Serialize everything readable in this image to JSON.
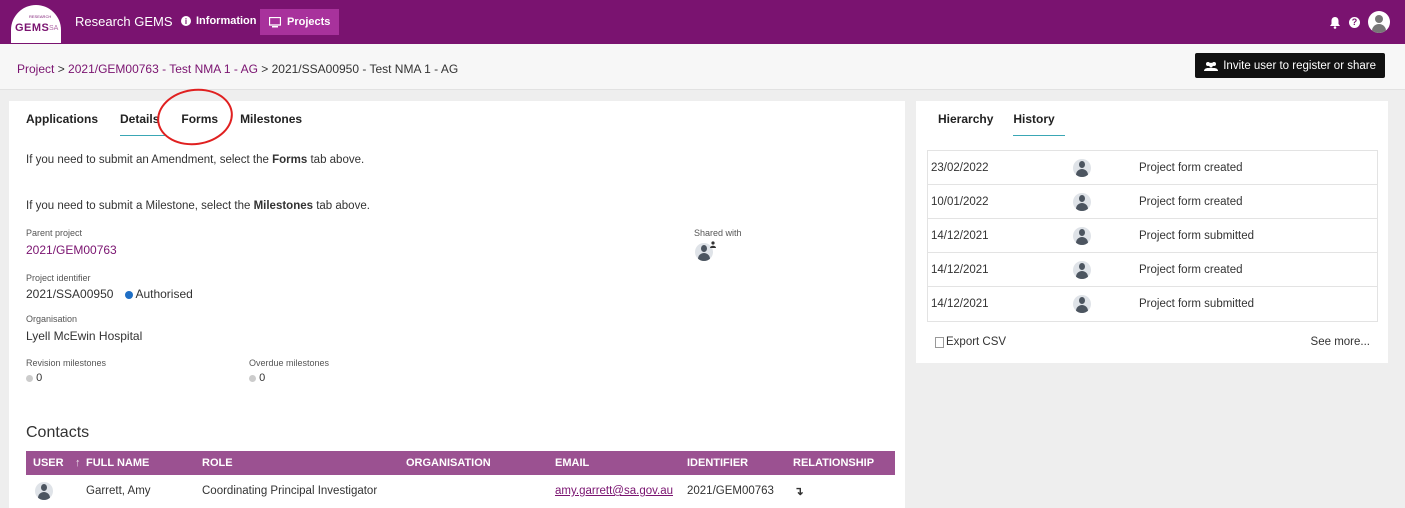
{
  "nav": {
    "logo_top": "RESEARCH",
    "logo_main": "GEMS",
    "logo_suffix": "SA",
    "brand": "Research GEMS",
    "info": "Information",
    "projects": "Projects"
  },
  "breadcrumb": {
    "root": "Project",
    "sep1": " > ",
    "parent": "2021/GEM00763 - Test NMA 1 - AG",
    "sep2": " > ",
    "current": "2021/SSA00950 - Test NMA 1 - AG"
  },
  "invite_button": "Invite user to register or share",
  "tabs": [
    "Applications",
    "Details",
    "Forms",
    "Milestones"
  ],
  "details": {
    "amend_pre": "If you need to submit an Amendment, select the ",
    "amend_bold": "Forms",
    "amend_post": " tab above.",
    "mile_pre": "If you need to submit a Milestone, select the ",
    "mile_bold": "Milestones",
    "mile_post": " tab above.",
    "parent_label": "Parent project",
    "parent_value": "2021/GEM00763",
    "shared_label": "Shared with",
    "identifier_label": "Project identifier",
    "identifier_value": "2021/SSA00950",
    "status": "Authorised",
    "status_color": "#1f6fc5",
    "org_label": "Organisation",
    "org_value": "Lyell McEwin Hospital",
    "revision_label": "Revision milestones",
    "revision_value": "0",
    "overdue_label": "Overdue milestones",
    "overdue_value": "0"
  },
  "contacts": {
    "title": "Contacts",
    "headers": [
      "USER",
      "↑",
      "FULL NAME",
      "ROLE",
      "ORGANISATION",
      "EMAIL",
      "IDENTIFIER",
      "RELATIONSHIP"
    ],
    "rows": [
      {
        "name": "Garrett, Amy",
        "role": "Coordinating Principal Investigator",
        "organisation": "",
        "email": "amy.garrett@sa.gov.au",
        "identifier": "2021/GEM00763",
        "relationship": "↴"
      }
    ]
  },
  "right_tabs": [
    "Hierarchy",
    "History"
  ],
  "history": [
    {
      "date": "23/02/2022",
      "event": "Project form created"
    },
    {
      "date": "10/01/2022",
      "event": "Project form created"
    },
    {
      "date": "14/12/2021",
      "event": "Project form submitted"
    },
    {
      "date": "14/12/2021",
      "event": "Project form created"
    },
    {
      "date": "14/12/2021",
      "event": "Project form submitted"
    }
  ],
  "export_csv": "Export CSV",
  "see_more": "See more..."
}
